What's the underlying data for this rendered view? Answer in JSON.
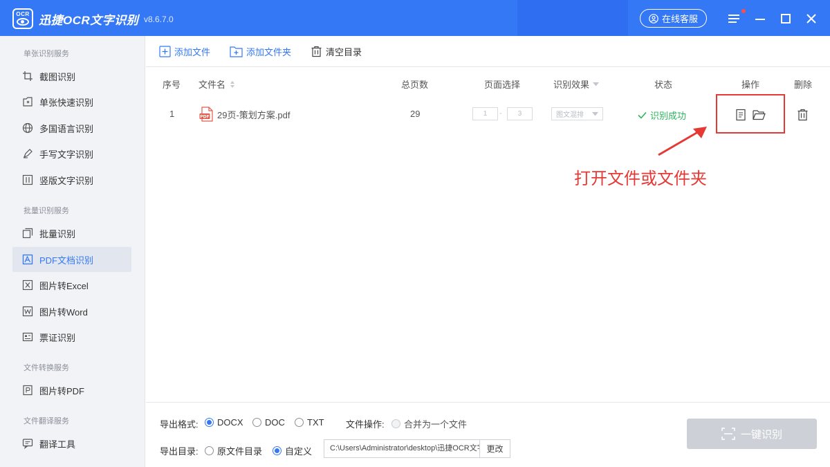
{
  "app": {
    "title": "迅捷OCR文字识别",
    "version": "v8.6.7.0",
    "logo_text": "OCR",
    "online_service": "在线客服",
    "brand_color": "#3478f6"
  },
  "sidebar": {
    "sections": [
      {
        "title": "单张识别服务",
        "items": [
          {
            "label": "截图识别",
            "icon": "crop-icon"
          },
          {
            "label": "单张快速识别",
            "icon": "quick-scan-icon"
          },
          {
            "label": "多国语言识别",
            "icon": "globe-icon"
          },
          {
            "label": "手写文字识别",
            "icon": "pen-icon"
          },
          {
            "label": "竖版文字识别",
            "icon": "vertical-text-icon"
          }
        ]
      },
      {
        "title": "批量识别服务",
        "items": [
          {
            "label": "批量识别",
            "icon": "batch-icon"
          },
          {
            "label": "PDF文档识别",
            "icon": "pdf-icon",
            "active": true
          },
          {
            "label": "图片转Excel",
            "icon": "excel-icon"
          },
          {
            "label": "图片转Word",
            "icon": "word-icon"
          },
          {
            "label": "票证识别",
            "icon": "ticket-icon"
          }
        ]
      },
      {
        "title": "文件转换服务",
        "items": [
          {
            "label": "图片转PDF",
            "icon": "image-pdf-icon"
          }
        ]
      },
      {
        "title": "文件翻译服务",
        "items": [
          {
            "label": "翻译工具",
            "icon": "translate-icon"
          }
        ]
      }
    ]
  },
  "toolbar": {
    "add_file": "添加文件",
    "add_folder": "添加文件夹",
    "clear": "清空目录"
  },
  "table": {
    "columns": {
      "index": "序号",
      "filename": "文件名",
      "total_pages": "总页数",
      "page_select": "页面选择",
      "effect": "识别效果",
      "status": "状态",
      "actions": "操作",
      "delete": "删除"
    },
    "rows": [
      {
        "index": "1",
        "filename": "29页-策划方案.pdf",
        "total_pages": "29",
        "page_from": "1",
        "page_to": "3",
        "page_sep": "-",
        "effect": "图文混排",
        "status": "识别成功"
      }
    ]
  },
  "annotation": {
    "text": "打开文件或文件夹",
    "color": "#e53935"
  },
  "footer": {
    "format_label": "导出格式:",
    "formats": [
      "DOCX",
      "DOC",
      "TXT"
    ],
    "selected_format": "DOCX",
    "file_op_label": "文件操作:",
    "merge_option": "合并为一个文件",
    "dir_label": "导出目录:",
    "dir_options": [
      "原文件目录",
      "自定义"
    ],
    "selected_dir": "自定义",
    "path": "C:\\Users\\Administrator\\desktop\\迅捷OCR文字识别",
    "change_button": "更改",
    "start_button": "一键识别"
  }
}
